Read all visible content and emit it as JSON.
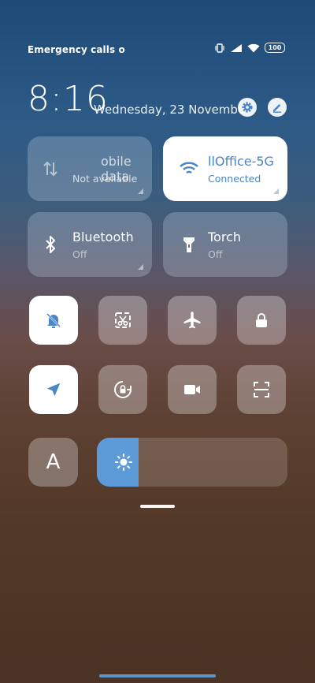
{
  "status_bar": {
    "carrier": "Emergency calls o",
    "battery": "100"
  },
  "header": {
    "time": "8:16",
    "date": "Wednesday, 23 November"
  },
  "tiles": {
    "mobile_data": {
      "title": "obile data",
      "subtitle": "Not available"
    },
    "wifi": {
      "title": "llOffice-5G",
      "subtitle": "Connected"
    },
    "bluetooth": {
      "title": "Bluetooth",
      "subtitle": "Off"
    },
    "torch": {
      "title": "Torch",
      "subtitle": "Off"
    }
  },
  "font_button": {
    "label": "A"
  },
  "brightness": {
    "level": 0.22
  },
  "colors": {
    "accent": "#5d9ad8",
    "active_text": "#4a86c5"
  },
  "icons": [
    "data-arrows-icon",
    "wifi-icon",
    "bluetooth-icon",
    "torch-icon",
    "mute-bell-icon",
    "screenshot-icon",
    "airplane-icon",
    "lock-icon",
    "location-icon",
    "rotation-lock-icon",
    "video-camera-icon",
    "scan-icon",
    "sun-icon",
    "gear-icon",
    "pencil-icon"
  ]
}
